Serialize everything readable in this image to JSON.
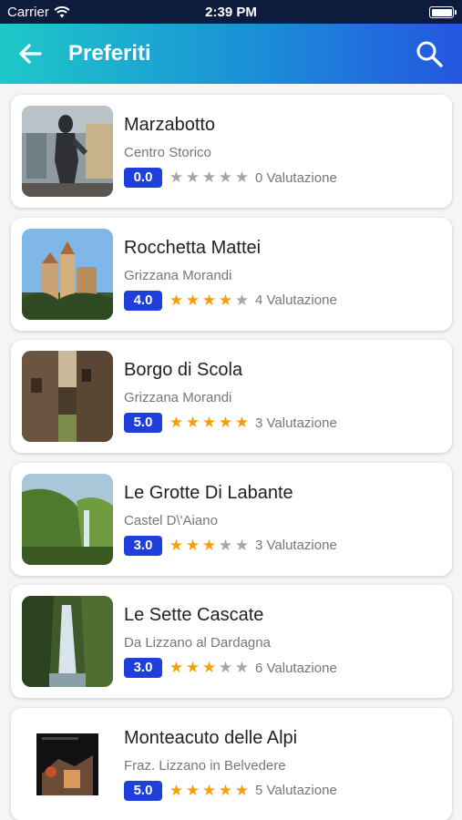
{
  "status_bar": {
    "carrier": "Carrier",
    "time": "2:39 PM"
  },
  "header": {
    "title": "Preferiti"
  },
  "colors": {
    "header_start": "#1ec8c8",
    "header_end": "#2456e0",
    "badge": "#1f3fdd",
    "star_on": "#f5a00a",
    "star_off": "#a6a6a6"
  },
  "places": [
    {
      "name": "Marzabotto",
      "location": "Centro Storico",
      "score": "0.0",
      "stars": 0,
      "reviews": "0 Valutazione"
    },
    {
      "name": "Rocchetta Mattei",
      "location": "Grizzana Morandi",
      "score": "4.0",
      "stars": 4,
      "reviews": "4 Valutazione"
    },
    {
      "name": "Borgo di Scola",
      "location": "Grizzana Morandi",
      "score": "5.0",
      "stars": 5,
      "reviews": "3 Valutazione"
    },
    {
      "name": "Le Grotte Di Labante",
      "location": "Castel D\\'Aiano",
      "score": "3.0",
      "stars": 3,
      "reviews": "3 Valutazione"
    },
    {
      "name": "Le Sette Cascate",
      "location": "Da Lizzano al Dardagna",
      "score": "3.0",
      "stars": 3,
      "reviews": "6 Valutazione"
    },
    {
      "name": "Monteacuto delle Alpi",
      "location": "Fraz. Lizzano in Belvedere",
      "score": "5.0",
      "stars": 5,
      "reviews": "5 Valutazione"
    }
  ]
}
